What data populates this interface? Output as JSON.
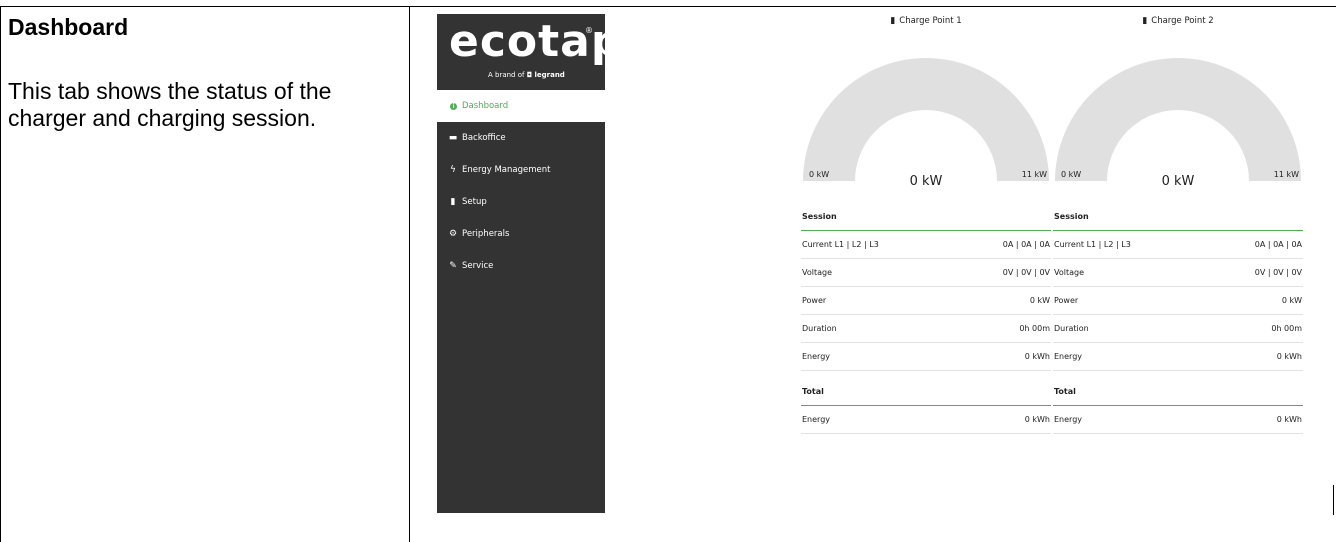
{
  "doc": {
    "title": "Dashboard",
    "description": "This tab shows the status of the charger and charging session."
  },
  "app": {
    "logo": {
      "name": "ecotap",
      "tagline": "A brand of",
      "brand": "legrand"
    },
    "nav": [
      {
        "label": "Dashboard",
        "icon": "info-circle-icon",
        "active": true
      },
      {
        "label": "Backoffice",
        "icon": "briefcase-icon"
      },
      {
        "label": "Energy Management",
        "icon": "bolt-icon"
      },
      {
        "label": "Setup",
        "icon": "charge-station-icon"
      },
      {
        "label": "Peripherals",
        "icon": "cogs-icon"
      },
      {
        "label": "Service",
        "icon": "wrench-icon"
      }
    ],
    "accent_color": "#4caf50",
    "sidebar_color": "#333333"
  },
  "charge_points": [
    {
      "title": "Charge Point 1",
      "gauge": {
        "min": "0 kW",
        "value": "0 kW",
        "max": "11 kW",
        "fill": 0
      },
      "session_heading": "Session",
      "session_rows": [
        {
          "label": "Current L1 | L2 | L3",
          "value": "0A | 0A | 0A"
        },
        {
          "label": "Voltage",
          "value": "0V | 0V | 0V"
        },
        {
          "label": "Power",
          "value": "0 kW"
        },
        {
          "label": "Duration",
          "value": "0h 00m"
        },
        {
          "label": "Energy",
          "value": "0 kWh"
        }
      ],
      "total_heading": "Total",
      "total_rows": [
        {
          "label": "Energy",
          "value": "0 kWh"
        }
      ]
    },
    {
      "title": "Charge Point 2",
      "gauge": {
        "min": "0 kW",
        "value": "0 kW",
        "max": "11 kW",
        "fill": 0
      },
      "session_heading": "Session",
      "session_rows": [
        {
          "label": "Current L1 | L2 | L3",
          "value": "0A | 0A | 0A"
        },
        {
          "label": "Voltage",
          "value": "0V | 0V | 0V"
        },
        {
          "label": "Power",
          "value": "0 kW"
        },
        {
          "label": "Duration",
          "value": "0h 00m"
        },
        {
          "label": "Energy",
          "value": "0 kWh"
        }
      ],
      "total_heading": "Total",
      "total_rows": [
        {
          "label": "Energy",
          "value": "0 kWh"
        }
      ]
    }
  ]
}
